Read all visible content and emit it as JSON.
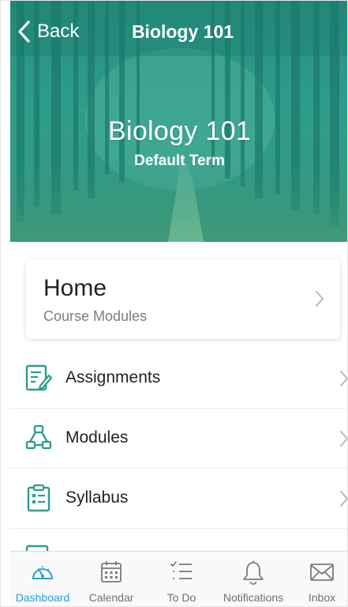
{
  "nav": {
    "back_label": "Back",
    "title": "Biology 101"
  },
  "course": {
    "title": "Biology 101",
    "term": "Default Term",
    "brand_color": "#3aa392"
  },
  "home_card": {
    "title": "Home",
    "subtitle": "Course Modules"
  },
  "menu": {
    "items": [
      {
        "label": "Assignments",
        "icon": "assignments-icon"
      },
      {
        "label": "Modules",
        "icon": "modules-icon"
      },
      {
        "label": "Syllabus",
        "icon": "syllabus-icon"
      }
    ]
  },
  "tabbar": {
    "active_color": "#2a9fd6",
    "tabs": [
      {
        "label": "Dashboard",
        "icon": "dashboard-icon",
        "active": true
      },
      {
        "label": "Calendar",
        "icon": "calendar-icon",
        "active": false
      },
      {
        "label": "To Do",
        "icon": "todo-icon",
        "active": false
      },
      {
        "label": "Notifications",
        "icon": "bell-icon",
        "active": false
      },
      {
        "label": "Inbox",
        "icon": "inbox-icon",
        "active": false
      }
    ]
  }
}
